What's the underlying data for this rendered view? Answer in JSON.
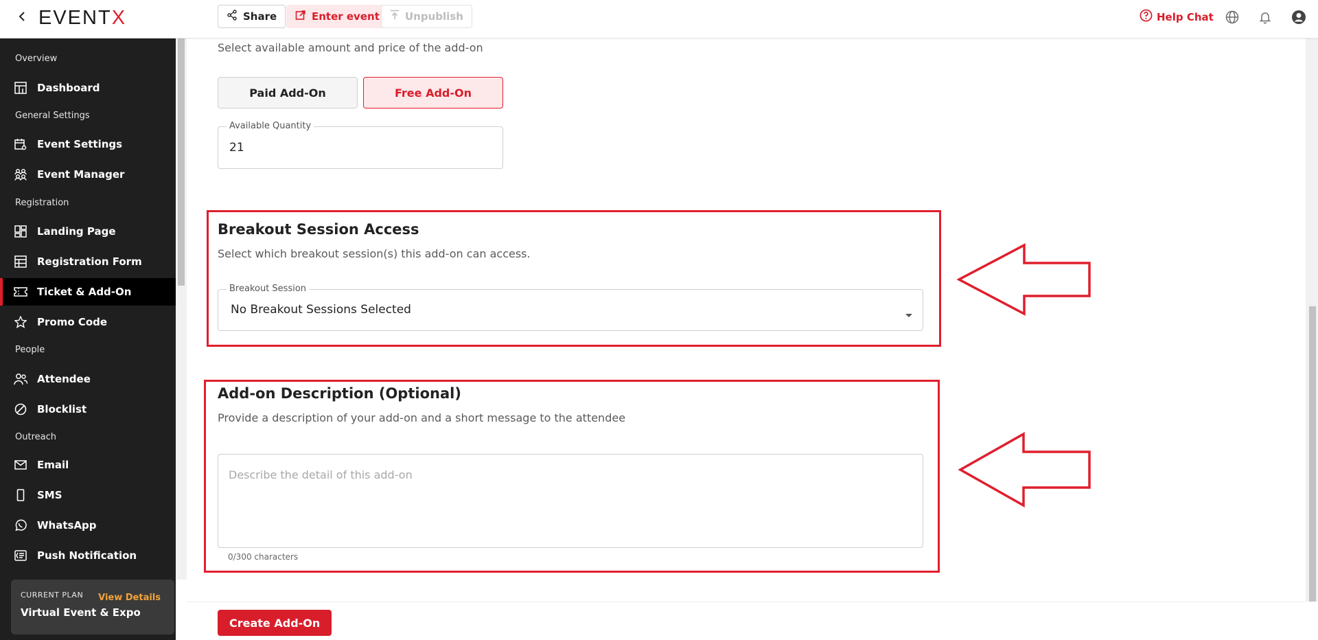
{
  "app": {
    "logo_text": "EVENT",
    "logo_accent": "X"
  },
  "topbar": {
    "share_label": "Share",
    "enter_label": "Enter event",
    "unpublish_label": "Unpublish",
    "help_label": "Help Chat"
  },
  "sidebar": {
    "sections": {
      "overview": "Overview",
      "general": "General Settings",
      "registration": "Registration",
      "people": "People",
      "outreach": "Outreach"
    },
    "items": {
      "dashboard": "Dashboard",
      "event_settings": "Event Settings",
      "event_manager": "Event Manager",
      "landing_page": "Landing Page",
      "registration_form": "Registration Form",
      "ticket_addon": "Ticket & Add-On",
      "promo_code": "Promo Code",
      "attendee": "Attendee",
      "blocklist": "Blocklist",
      "email": "Email",
      "sms": "SMS",
      "whatsapp": "WhatsApp",
      "push_notification": "Push Notification"
    },
    "plan": {
      "label": "CURRENT PLAN",
      "view_details": "View Details",
      "name": "Virtual Event & Expo"
    }
  },
  "form": {
    "pricing": {
      "subtitle": "Select available amount and price of the add-on",
      "paid_label": "Paid Add-On",
      "free_label": "Free Add-On",
      "selected": "Free Add-On",
      "quantity_label": "Available Quantity",
      "quantity_value": "21"
    },
    "breakout": {
      "title": "Breakout Session Access",
      "subtitle": "Select which breakout session(s) this add-on can access.",
      "field_label": "Breakout Session",
      "selected_value": "No Breakout Sessions Selected"
    },
    "description": {
      "title": "Add-on Description (Optional)",
      "subtitle": "Provide a description of your add-on and a short message to the attendee",
      "placeholder": "Describe the detail of this add-on",
      "counter": "0/300 characters"
    },
    "submit_label": "Create Add-On"
  },
  "colors": {
    "accent": "#e01e2d",
    "sidebar_bg": "#1f1f1f",
    "plan_link": "#f2a33a"
  }
}
